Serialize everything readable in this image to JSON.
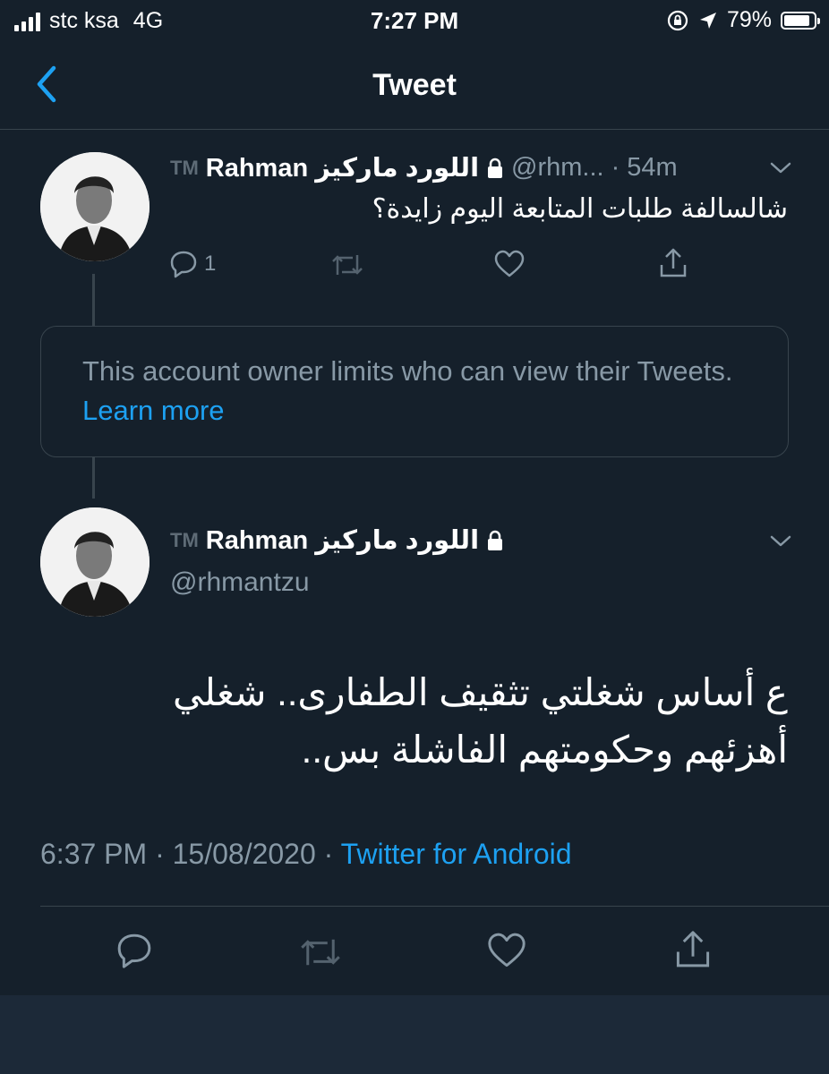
{
  "status_bar": {
    "carrier": "stc ksa",
    "network": "4G",
    "time": "7:27 PM",
    "battery": "79%",
    "battery_level": 0.79
  },
  "header": {
    "title": "Tweet"
  },
  "reply_tweet": {
    "tm": "TM",
    "name": "Rahman اللورد ماركيز",
    "handle": "@rhm...",
    "time": "54m",
    "text": "شالسالفة طلبات المتابعة اليوم زايدة؟",
    "reply_count": "1"
  },
  "notice": {
    "text": "This account owner limits who can view their Tweets.",
    "link": "Learn more"
  },
  "main_tweet": {
    "tm": "TM",
    "name": "Rahman اللورد ماركيز",
    "handle": "@rhmantzu",
    "text": "ع أساس شغلتي تثقيف الطفارى.. شغلي أهزئهم وحكومتهم الفاشلة بس..",
    "timestamp": "6:37 PM · 15/08/2020 ·",
    "source": "Twitter for Android"
  },
  "colors": {
    "background": "#15202b",
    "accent": "#1da1f2",
    "muted": "#8899a6",
    "border": "#38444d"
  },
  "icons": [
    "back-chevron-icon",
    "lock-icon",
    "chevron-down-icon",
    "reply-icon",
    "retweet-icon",
    "like-icon",
    "share-icon"
  ]
}
